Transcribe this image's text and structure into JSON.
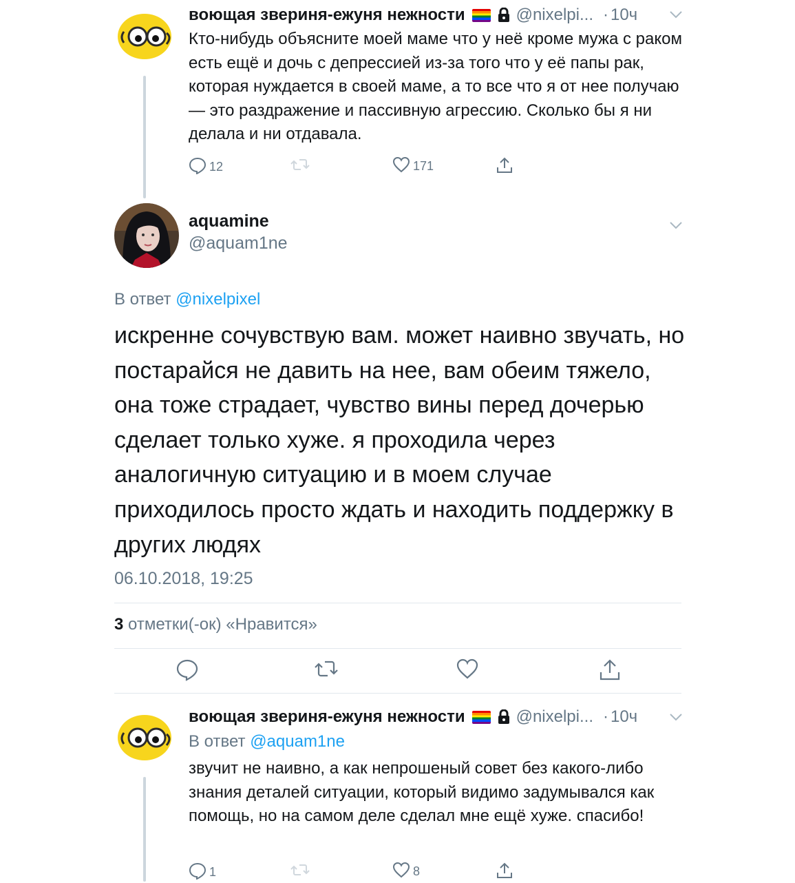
{
  "tweet1": {
    "name": "воющая звериня-ежуня нежности",
    "handle": "@nixelpi...",
    "time": "10ч",
    "text": "Кто-нибудь объясните моей маме что у неё кроме мужа с раком есть ещё и дочь с депрессией из-за того что у её папы рак, которая нуждается в своей маме, а то все что я от нее получаю — это раздражение и пассивную агрессию. Сколько бы я ни делала и ни отдавала.",
    "replies": "12",
    "likes": "171"
  },
  "main_tweet": {
    "name": "aquamine",
    "handle": "@aquam1ne",
    "reply_prefix": "В ответ",
    "reply_mention": "@nixelpixel",
    "text": "искренне сочувствую вам. может наивно звучать, но постарайся не давить на нее, вам обеим тяжело, она тоже страдает, чувство вины перед дочерью сделает только хуже. я проходила через аналогичную ситуацию и в моем случае приходилось просто ждать и находить поддержку в других людях",
    "date": "06.10.2018, 19:25",
    "likes_count": "3",
    "likes_label": "отметки(-ок) «Нравится»"
  },
  "tweet3": {
    "name": "воющая звериня-ежуня нежности",
    "handle": "@nixelpi...",
    "time": "10ч",
    "reply_prefix": "В ответ",
    "reply_mention": "@aquam1ne",
    "text": "звучит не наивно, а как непрошеный совет без какого-либо знания деталей ситуации, который видимо задумывался как помощь, но на самом деле сделал мне ещё хуже. спасибо!",
    "replies": "1",
    "likes": "8"
  },
  "separator_dot": "·",
  "colors": {
    "accent": "#1da1f2",
    "secondary_text": "#657786",
    "icon": "#657786",
    "divider": "#e1e8ed",
    "thread_line": "#ccd6dd"
  },
  "icons": [
    "reply-icon",
    "retweet-icon",
    "like-icon",
    "share-icon",
    "lock-icon",
    "chevron-down-icon",
    "rainbow-flag-icon"
  ]
}
